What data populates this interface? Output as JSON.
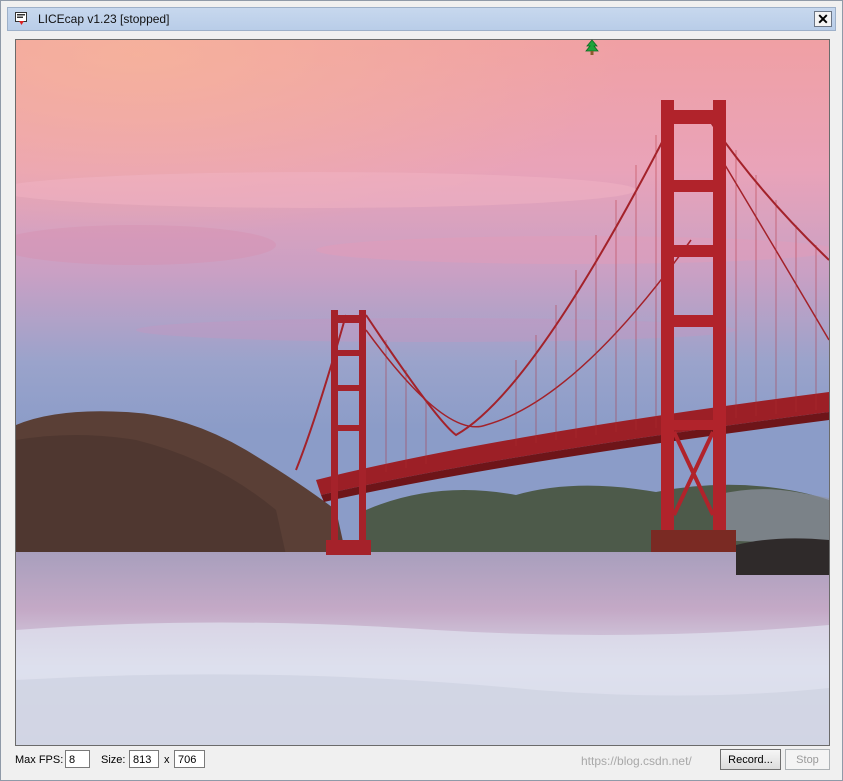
{
  "window": {
    "title": "LICEcap v1.23 [stopped]",
    "close_label": "✕"
  },
  "controls": {
    "max_fps_label": "Max FPS:",
    "max_fps_value": "8",
    "size_label": "Size:",
    "width_value": "813",
    "x_label": "x",
    "height_value": "706",
    "record_label": "Record...",
    "stop_label": "Stop"
  },
  "watermark": "https://blog.csdn.net/",
  "icons": {
    "app": "licecap-app-icon",
    "tree": "tree-icon",
    "close": "close-icon"
  },
  "colors": {
    "titlebar": "#c7d8ee",
    "bridge": "#b5252b"
  }
}
